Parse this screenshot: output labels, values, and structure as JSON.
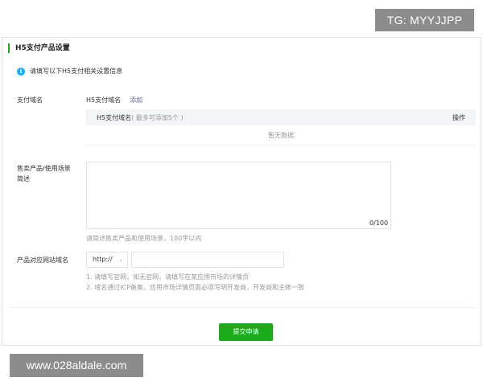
{
  "watermarks": {
    "top": "TG: MYYJJPP",
    "bottom": "www.028aldale.com"
  },
  "section": {
    "title": "H5支付产品设置",
    "notice": "请填写以下H5支付相关设置信息"
  },
  "pay_domain": {
    "label": "支付域名",
    "field_label": "H5支付域名",
    "add_link": "添加",
    "table": {
      "col_domain": "H5支付域名",
      "col_domain_hint": "( 最多可添加5个 )",
      "col_action": "操作",
      "empty": "暂无数据"
    }
  },
  "product_desc": {
    "label_line1": "售卖产品/使用场景",
    "label_line2": "简述",
    "value": "",
    "counter": "0/100",
    "hint": "请简述售卖产品和使用场景，100字以内"
  },
  "website": {
    "label": "产品对应网站域名",
    "protocol": "http://",
    "caret": "⌄",
    "url_value": "",
    "notes": [
      "1. 请填写官网，如无官网，请填写在某应用市场的详情页",
      "2. 域名通过ICP备案，应用市场详情页面必须写明开发商，开发商和主体一致"
    ]
  },
  "submit_label": "提交申请",
  "icons": {
    "info": "i"
  },
  "colors": {
    "accent_green": "#1aad19",
    "link_blue": "#576b95",
    "info_blue": "#10aeff"
  }
}
